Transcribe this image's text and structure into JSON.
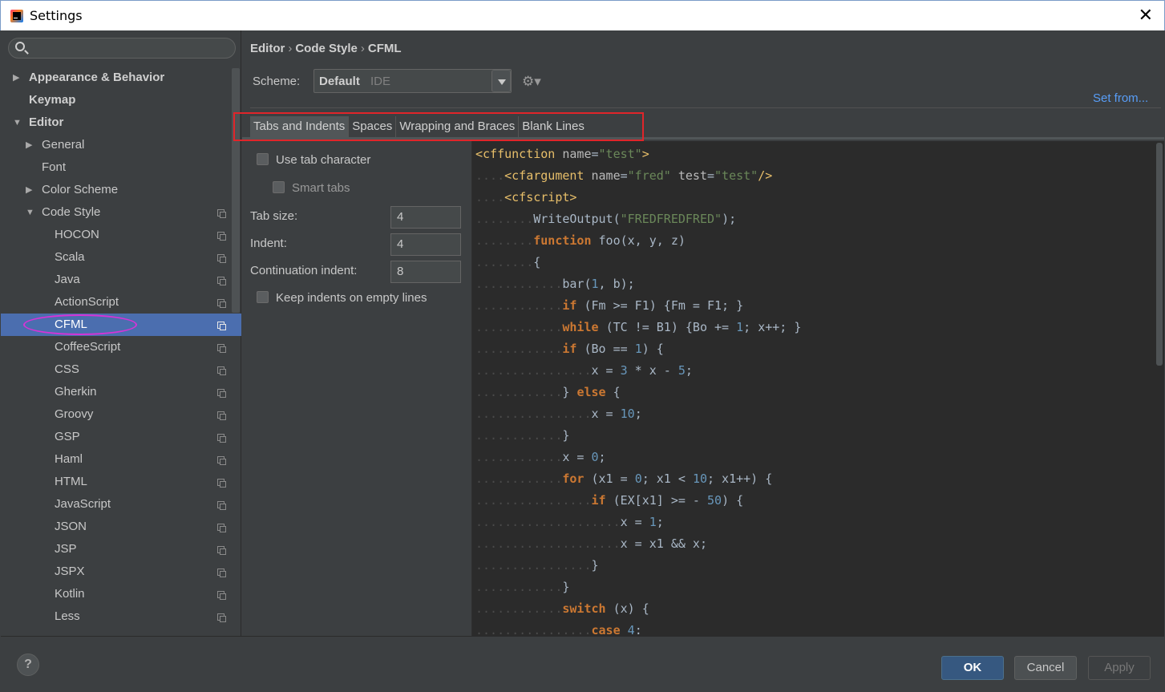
{
  "window": {
    "title": "Settings",
    "close_glyph": "✕"
  },
  "search": {
    "placeholder": ""
  },
  "tree": {
    "appearance": "Appearance & Behavior",
    "keymap": "Keymap",
    "editor": "Editor",
    "general": "General",
    "font": "Font",
    "color_scheme": "Color Scheme",
    "code_style": "Code Style",
    "languages": [
      "HOCON",
      "Scala",
      "Java",
      "ActionScript",
      "CFML",
      "CoffeeScript",
      "CSS",
      "Gherkin",
      "Groovy",
      "GSP",
      "Haml",
      "HTML",
      "JavaScript",
      "JSON",
      "JSP",
      "JSPX",
      "Kotlin",
      "Less"
    ],
    "selected": "CFML"
  },
  "breadcrumb": {
    "part1": "Editor",
    "part2": "Code Style",
    "part3": "CFML",
    "sep": "›"
  },
  "scheme": {
    "label": "Scheme:",
    "value": "Default",
    "sub": "IDE"
  },
  "set_from": "Set from...",
  "tabs": [
    "Tabs and Indents",
    "Spaces",
    "Wrapping and Braces",
    "Blank Lines"
  ],
  "options": {
    "use_tab": "Use tab character",
    "smart_tabs": "Smart tabs",
    "tab_size_label": "Tab size:",
    "tab_size": "4",
    "indent_label": "Indent:",
    "indent": "4",
    "cont_label": "Continuation indent:",
    "cont": "8",
    "keep_indents": "Keep indents on empty lines"
  },
  "code": {
    "l1_tag": "<cffunction",
    "l1_attr": "name",
    "l1_val": "\"test\"",
    "l2_tag": "<cfargument",
    "l2_attr1": "name",
    "l2_val1": "\"fred\"",
    "l2_attr2": "test",
    "l2_val2": "\"test\"",
    "l3_tag": "<cfscript>",
    "l4_fn": "WriteOutput(",
    "l4_str": "\"FREDFREDFRED\"",
    "l5_kw": "function",
    "l5_rest": " foo(x, y, z)",
    "l7_a": "bar(",
    "l7_n": "1",
    "l7_b": ", b);",
    "l8": "(Fm >= F1) {Fm = F1; }",
    "l9": "(TC != B1) {Bo += ",
    "l9_n": "1",
    "l9_b": "; x++; }",
    "l10": "(Bo == ",
    "l10_n": "1",
    "l10_b": ") {",
    "l11_a": "x = ",
    "l11_n1": "3",
    "l11_b": " * x - ",
    "l11_n2": "5",
    "l13_kw": "else",
    "l14_n": "10",
    "l16_n": "0",
    "l17_a": "(x1 = ",
    "l17_n1": "0",
    "l17_b": "; x1 < ",
    "l17_n2": "10",
    "l17_c": "; x1++) {",
    "l18_a": "(EX[x1] >= - ",
    "l18_n": "50",
    "l18_b": ") {",
    "l19_n": "1",
    "l20": "x = x1 && x;",
    "l23_kw": "switch",
    "l23_rest": " (x) {",
    "l24_kw": "case",
    "l24_n": "4"
  },
  "footer": {
    "help": "?",
    "ok": "OK",
    "cancel": "Cancel",
    "apply": "Apply"
  },
  "colors": {
    "selection": "#4b6eaf",
    "link": "#589df6",
    "highlight_red": "#e0252a",
    "highlight_magenta": "#d633d6"
  }
}
